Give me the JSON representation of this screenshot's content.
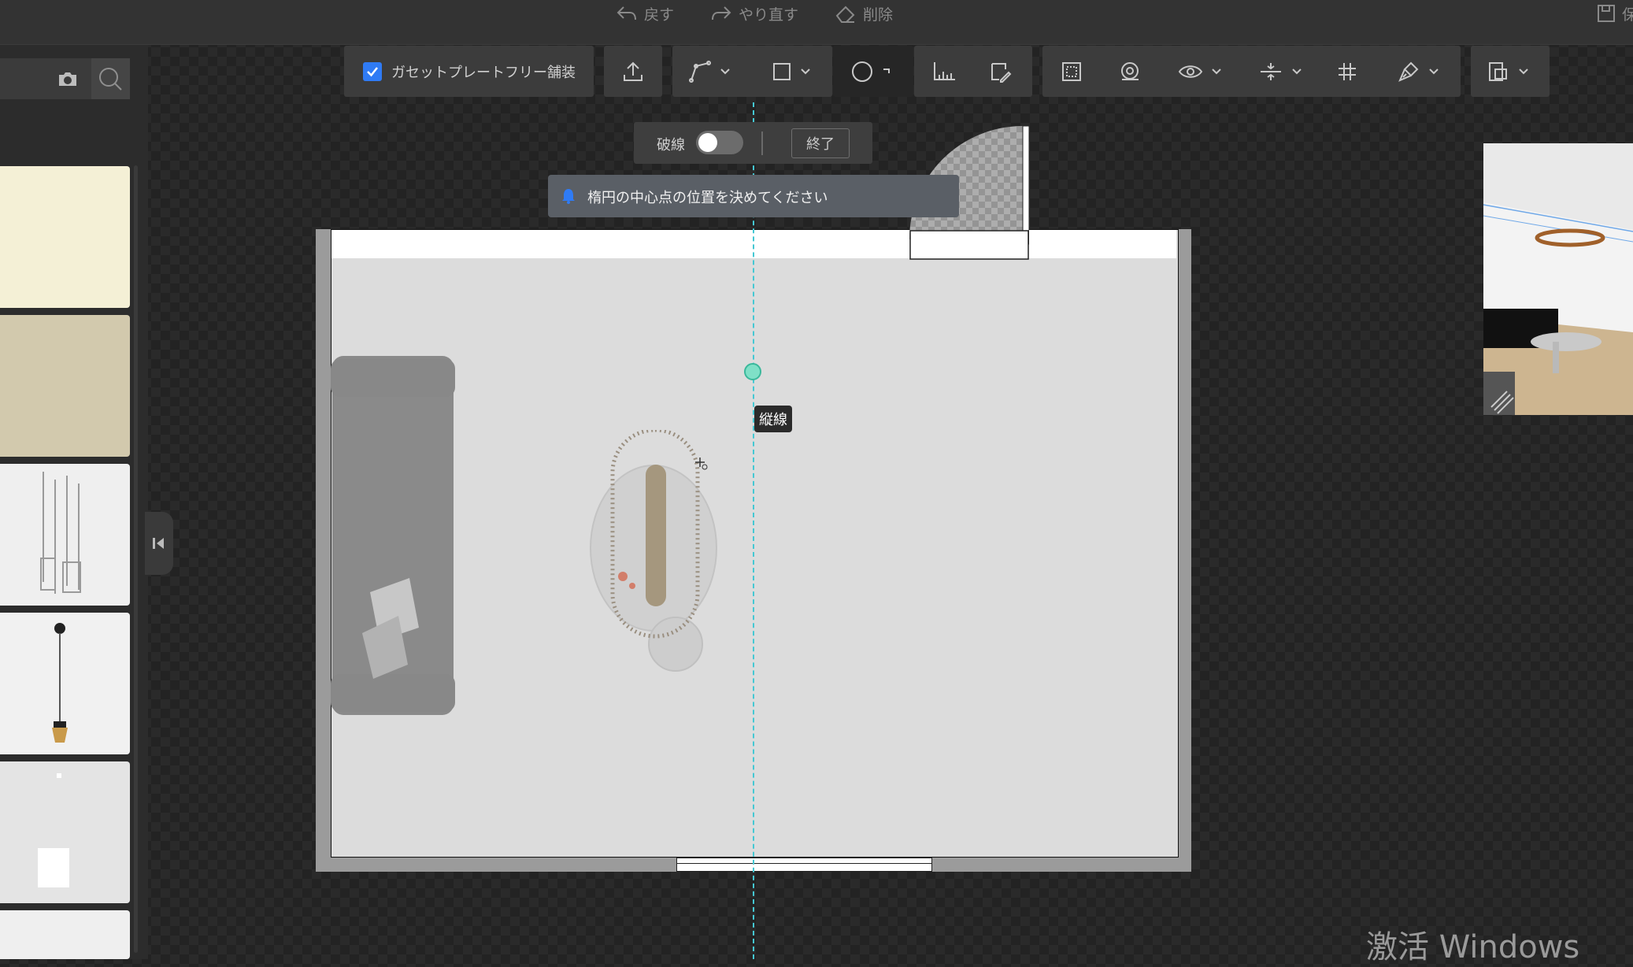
{
  "topmenu": {
    "undo": "戻す",
    "redo": "やり直す",
    "delete": "削除",
    "save_partial": "保"
  },
  "toolbar": {
    "gusset_checkbox_label": "ガセットプレートフリー舗装",
    "gusset_checked": true
  },
  "dashed_panel": {
    "label": "破線",
    "toggle_on": false,
    "finish_button": "終了"
  },
  "toast": {
    "message": "楕円の中心点の位置を決めてください"
  },
  "canvas": {
    "vertical_line_label": "縦線"
  },
  "watermark": "激活 Windows",
  "colors": {
    "accent_blue": "#2f7bf5",
    "guide_cyan": "#45c8d3",
    "marker_green": "#7fe0c7"
  }
}
